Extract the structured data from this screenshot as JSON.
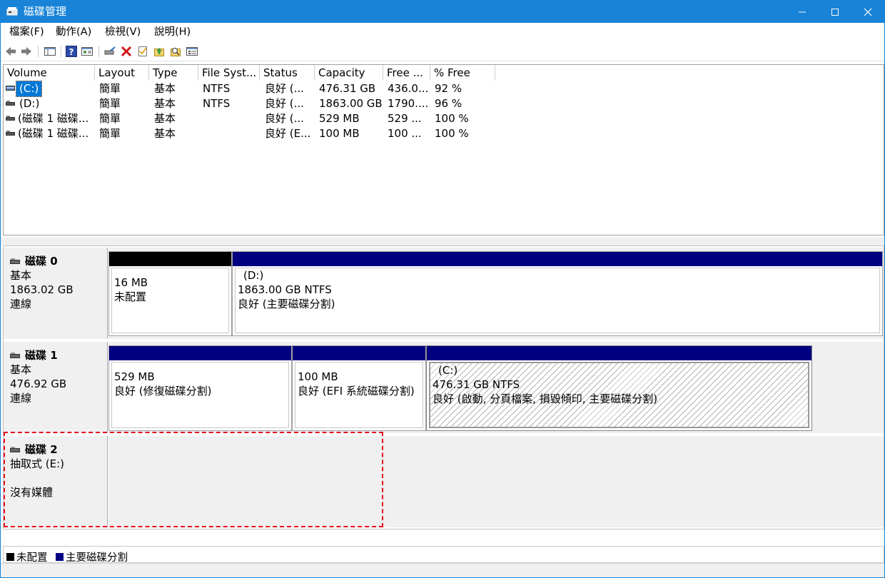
{
  "window": {
    "title": "磁碟管理",
    "minimize": "minimize",
    "maximize": "maximize",
    "close": "close"
  },
  "menu": [
    "檔案(F)",
    "動作(A)",
    "檢視(V)",
    "說明(H)"
  ],
  "toolbar_icons": [
    "back-icon",
    "forward-icon",
    "console-tree-icon",
    "help-icon",
    "show-pane-icon",
    "connect-icon",
    "delete-icon",
    "properties-icon",
    "up-icon",
    "search-icon",
    "settings-icon"
  ],
  "volume_list": {
    "columns": [
      "Volume",
      "Layout",
      "Type",
      "File Syst...",
      "Status",
      "Capacity",
      "Free ...",
      "% Free"
    ],
    "rows": [
      {
        "volume": "(C:)",
        "layout": "簡單",
        "type": "基本",
        "fs": "NTFS",
        "status": "良好 (...",
        "capacity": "476.31 GB",
        "free": "436.0...",
        "pct": "92 %",
        "selected": true
      },
      {
        "volume": "(D:)",
        "layout": "簡單",
        "type": "基本",
        "fs": "NTFS",
        "status": "良好 (...",
        "capacity": "1863.00 GB",
        "free": "1790....",
        "pct": "96 %"
      },
      {
        "volume": "(磁碟 1 磁碟...",
        "layout": "簡單",
        "type": "基本",
        "fs": "",
        "status": "良好 (...",
        "capacity": "529 MB",
        "free": "529 ...",
        "pct": "100 %"
      },
      {
        "volume": "(磁碟 1 磁碟...",
        "layout": "簡單",
        "type": "基本",
        "fs": "",
        "status": "良好 (E...",
        "capacity": "100 MB",
        "free": "100 ...",
        "pct": "100 %"
      }
    ]
  },
  "disks": [
    {
      "name": "磁碟 0",
      "type": "基本",
      "size": "1863.02 GB",
      "state": "連線",
      "parts": [
        {
          "size": "16 MB",
          "status": "未配置"
        },
        {
          "label": "(D:)",
          "size": "1863.00 GB NTFS",
          "status": "良好 (主要磁碟分割)"
        }
      ]
    },
    {
      "name": "磁碟 1",
      "type": "基本",
      "size": "476.92 GB",
      "state": "連線",
      "parts": [
        {
          "size": "529 MB",
          "status": "良好 (修復磁碟分割)"
        },
        {
          "size": "100 MB",
          "status": "良好 (EFI 系統磁碟分割)"
        },
        {
          "label": "(C:)",
          "size": "476.31 GB NTFS",
          "status": "良好 (啟動, 分頁檔案, 損毀傾印, 主要磁碟分割)"
        }
      ]
    },
    {
      "name": "磁碟 2",
      "type": "抽取式 (E:)",
      "size": "",
      "state": "沒有媒體"
    }
  ],
  "legend": [
    {
      "label": "未配置",
      "color": "#000000"
    },
    {
      "label": "主要磁碟分割",
      "color": "#000080"
    }
  ],
  "colors": {
    "titlebar": "#1883d7",
    "primary": "#000080",
    "unallocated": "#000000",
    "selection": "#0078d7",
    "highlight": "#e3101e"
  }
}
